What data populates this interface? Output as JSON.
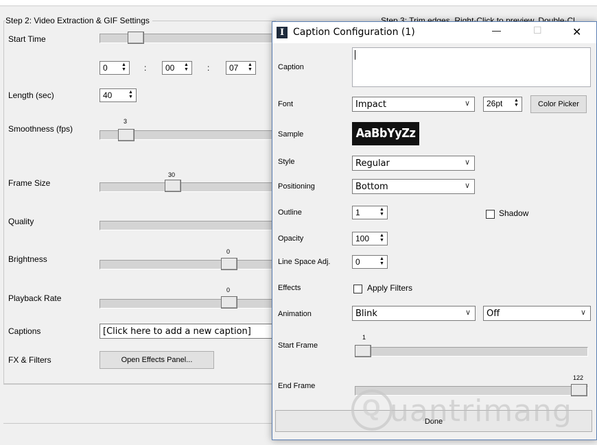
{
  "main": {
    "group_title": "Step 2: Video Extraction & GIF Settings",
    "step3_title": "Step 3: Trim edges. Right-Click to preview. Double-Cl",
    "start_time_label": "Start Time",
    "time_h": "0",
    "time_m": "00",
    "time_s": "07",
    "colon": ":",
    "length_label": "Length (sec)",
    "length_value": "40",
    "smoothness_label": "Smoothness (fps)",
    "smoothness_value": "3",
    "frame_size_label": "Frame Size",
    "frame_size_value": "30",
    "quality_label": "Quality",
    "brightness_label": "Brightness",
    "brightness_value": "0",
    "playback_label": "Playback Rate",
    "playback_value": "0",
    "captions_label": "Captions",
    "captions_value": "[Click here to add a new caption]",
    "fx_label": "FX & Filters",
    "fx_button": "Open Effects Panel..."
  },
  "dialog": {
    "title": "Caption Configuration (1)",
    "app_icon": "I",
    "minimize": "—",
    "maximize": "☐",
    "close": "✕",
    "caption_label": "Caption",
    "caption_value": "",
    "font_label": "Font",
    "font_value": "Impact",
    "font_size": "26pt",
    "color_picker": "Color Picker",
    "sample_label": "Sample",
    "sample_text": "AaBbYyZz",
    "style_label": "Style",
    "style_value": "Regular",
    "positioning_label": "Positioning",
    "positioning_value": "Bottom",
    "outline_label": "Outline",
    "outline_value": "1",
    "shadow_label": "Shadow",
    "opacity_label": "Opacity",
    "opacity_value": "100",
    "linespace_label": "Line Space Adj.",
    "linespace_value": "0",
    "effects_label": "Effects",
    "apply_filters_label": "Apply Filters",
    "animation_label": "Animation",
    "animation_value": "Blink",
    "animation_mode": "Off",
    "start_frame_label": "Start Frame",
    "start_frame_value": "1",
    "end_frame_label": "End Frame",
    "end_frame_value": "122",
    "done_button": "Done"
  },
  "watermark": {
    "text": "uantrimang",
    "letter": "Q"
  }
}
